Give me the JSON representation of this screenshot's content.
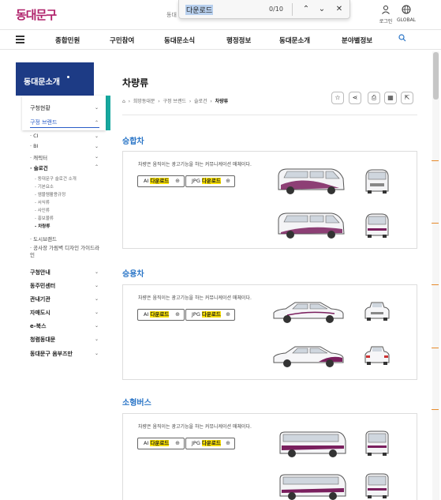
{
  "header": {
    "logo": "동대문구",
    "top_mini": "동대",
    "login_label": "로그인",
    "global_label": "GLOBAL"
  },
  "findbar": {
    "query": "다운로드",
    "count": "0/10",
    "prev": "⌃",
    "next": "⌄",
    "close": "✕"
  },
  "nav": {
    "items": [
      "종합민원",
      "구민참여",
      "동대문소식",
      "행정정보",
      "동대문소개",
      "분야별정보"
    ]
  },
  "sidebar": {
    "title": "동대문소개",
    "l1_top": [
      {
        "label": "구청현황",
        "chev": "⌄"
      },
      {
        "label": "구정 브랜드",
        "chev": "⌃"
      }
    ],
    "l2": [
      {
        "label": "CI",
        "chev": "⌄"
      },
      {
        "label": "BI",
        "chev": "⌄"
      },
      {
        "label": "캐릭터",
        "chev": "⌄"
      },
      {
        "label": "슬로건",
        "chev": "⌃"
      }
    ],
    "l3": [
      "동대문구 슬로건 소개",
      "기본요소",
      "엠블렘활용규정",
      "서식류",
      "사인류",
      "홍보물류",
      "차량류"
    ],
    "l2_after": [
      "도시브랜드",
      "공사장 가림벽 디자인 가이드라인"
    ],
    "l1_bottom": [
      "구청안내",
      "동주민센터",
      "관내기관",
      "자매도시",
      "e-북스",
      "청렴동대문",
      "동대문구 옴부즈만"
    ]
  },
  "content": {
    "title": "차량류",
    "breadcrumb": [
      "희망동대문",
      "구정 브랜드",
      "슬로건"
    ],
    "breadcrumb_current": "차량류",
    "sections": [
      {
        "title": "승합차",
        "desc": "차량은 움직이는 광고기능을 하는 커뮤니케이션 매체이다."
      },
      {
        "title": "승용차",
        "desc": "차량은 움직이는 광고기능을 하는 커뮤니케이션 매체이다."
      },
      {
        "title": "소형버스",
        "desc": "차량은 움직이는 광고기능을 하는 커뮤니케이션 매체이다."
      }
    ],
    "download": {
      "ai_prefix": "AI",
      "jpg_prefix": "JPG",
      "label": "다운로드",
      "icon": "⊕"
    }
  },
  "colors": {
    "accent_blue": "#2a75c7",
    "sidebar_navy": "#1d3b85",
    "sidebar_teal": "#17a9a0",
    "highlight": "#ffe500",
    "vehicle_purple": "#7a1f5e"
  }
}
